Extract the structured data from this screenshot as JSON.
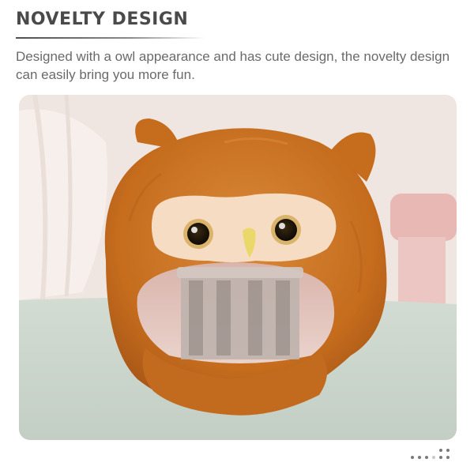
{
  "section": {
    "heading": "NOVELTY DESIGN",
    "description": "Designed with a owl appearance and has cute design, the novelty design can easily bring you more fun."
  },
  "product_photo": {
    "subject": "owl-hat",
    "colors": {
      "fur": "#c96f1c",
      "fur_shadow": "#a8571a",
      "face": "#f6dcc3",
      "beak": "#ecd96a",
      "lining": "#e6c7bf",
      "table": "#cfd9cf",
      "background": "#f1e7e2"
    }
  },
  "carousel": {
    "dots_count": 8
  }
}
